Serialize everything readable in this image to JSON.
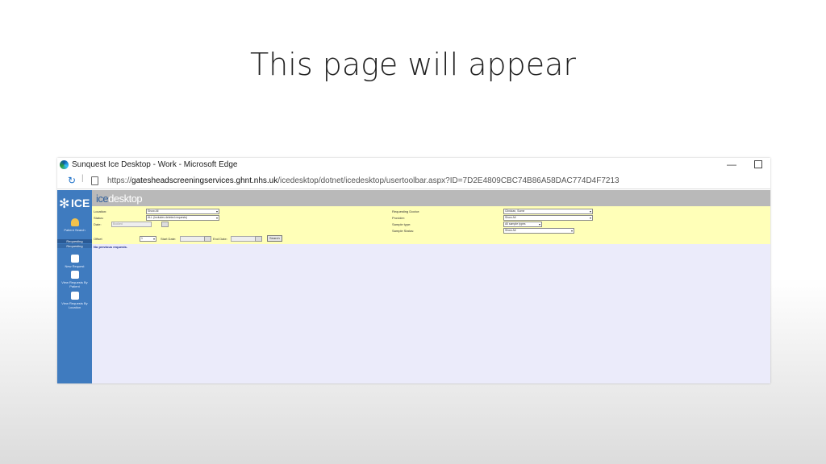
{
  "slide": {
    "title": "This page will appear"
  },
  "browser": {
    "window_title": "Sunquest Ice Desktop - Work - Microsoft Edge",
    "url_prefix": "https://",
    "url_host": "gatesheadscreeningservices.ghnt.nhs.uk",
    "url_path": "/icedesktop/dotnet/icedesktop/usertoolbar.aspx?ID=7D2E4809CBC74B86A58DAC774D4F7213"
  },
  "app": {
    "logo_text": "ICE",
    "brand_prefix": "ice",
    "brand_suffix": "desktop",
    "sidebar": {
      "patient_search": "Patient Search",
      "tab_requesting": "Requesting",
      "tab_requesting_sub": "Requesting",
      "new_request": "New Request",
      "view_by_patient": "View Requests By Patient",
      "view_by_location": "View Requests By Location"
    },
    "filters": {
      "location_label": "Location:",
      "location_value": "Show All",
      "status_label": "Status:",
      "status_value": "ALL (includes deleted requests)",
      "date_label": "Date:",
      "date_value": "Booked",
      "offset_label": "Offset",
      "offset_value": "1",
      "start_date_label": "Start Date:",
      "end_date_label": "End Date:",
      "search_button": "Search",
      "requesting_doctor_label": "Requesting Doctor:",
      "requesting_doctor_value": "Clinician, Some",
      "provider_label": "Provider:",
      "provider_value": "Show All",
      "sample_type_label": "Sample type:",
      "sample_type_value": "All sample types",
      "sample_status_label": "Sample Status:",
      "sample_status_value": "Show All"
    },
    "results_message": "No previous requests."
  }
}
